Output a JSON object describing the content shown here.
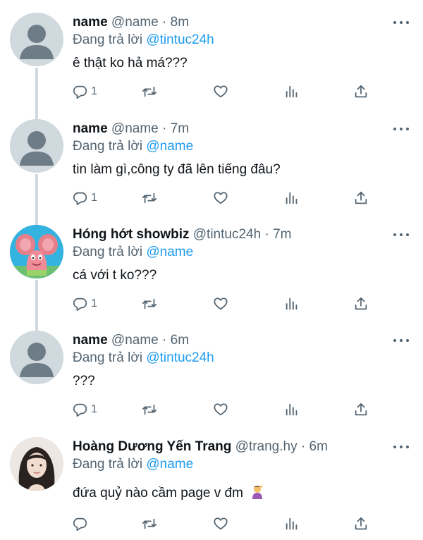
{
  "tweets": [
    {
      "name": "name",
      "handle": "@name",
      "dot": "·",
      "time": "8m",
      "replying_prefix": "Đang trả lời",
      "replying_to": "@tintuc24h",
      "text": "ê thật ko hả má???",
      "reply_count": "1",
      "avatar": "default-avatar"
    },
    {
      "name": "name",
      "handle": "@name",
      "dot": "·",
      "time": "7m",
      "replying_prefix": "Đang trả lời",
      "replying_to": "@name",
      "text": "tin làm gì,công ty đã lên tiếng đâu?",
      "reply_count": "1",
      "avatar": "default-avatar"
    },
    {
      "name": "Hóng hớt showbiz",
      "handle": "@tintuc24h",
      "dot": "·",
      "time": "7m",
      "replying_prefix": "Đang trả lời",
      "replying_to": "@name",
      "text": "cá với t ko???",
      "reply_count": "1",
      "avatar": "cartoon-avatar"
    },
    {
      "name": "name",
      "handle": "@name",
      "dot": "·",
      "time": "6m",
      "replying_prefix": "Đang trả lời",
      "replying_to": "@tintuc24h",
      "text": "???",
      "reply_count": "1",
      "avatar": "default-avatar"
    },
    {
      "name": "Hoàng Dương Yến Trang",
      "handle": "@trang.hy",
      "dot": "·",
      "time": "6m",
      "replying_prefix": "Đang trả lời",
      "replying_to": "@name",
      "text": "đứa quỷ nào cầm page v đm",
      "text_emoji": "facepalm-emoji",
      "reply_count": "",
      "avatar": "photo-avatar"
    }
  ],
  "colors": {
    "text": "#0f1419",
    "muted": "#536471",
    "link": "#1d9bf0",
    "thread_line": "#cfd9de"
  },
  "icons": [
    "reply-icon",
    "retweet-icon",
    "like-icon",
    "views-icon",
    "share-icon",
    "more-icon"
  ]
}
